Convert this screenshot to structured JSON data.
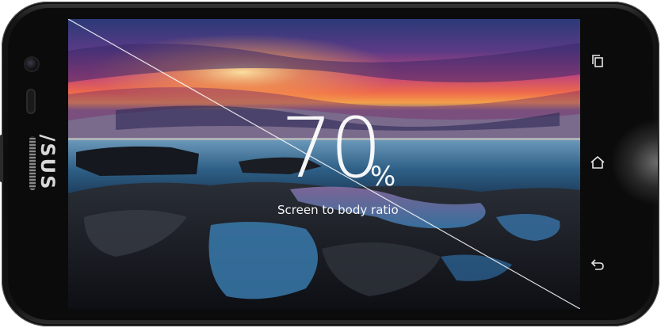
{
  "device": {
    "brand_label": "/SUS",
    "icons": {
      "camera": "front-camera-icon",
      "earpiece": "earpiece-icon",
      "speaker": "speaker-grille-icon",
      "recent": "recent-apps-icon",
      "home": "home-icon",
      "back": "back-icon"
    },
    "colors": {
      "bezel": "#0c0c0c",
      "text": "#ffffff"
    }
  },
  "screen": {
    "stat_value": "70",
    "stat_unit": "%",
    "stat_caption": "Screen to body ratio"
  }
}
